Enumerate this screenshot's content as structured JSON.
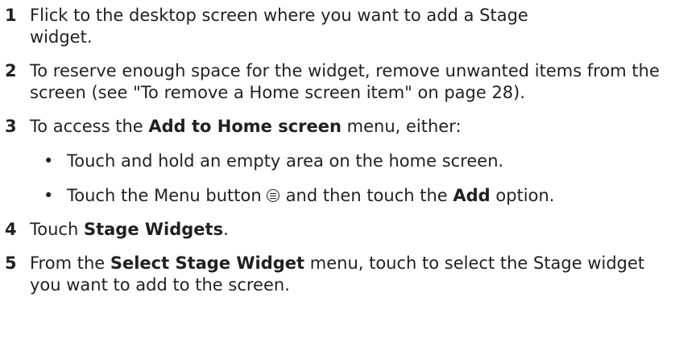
{
  "steps": [
    {
      "number": "1",
      "text": "Flick to the desktop screen where you want to add a Stage widget."
    },
    {
      "number": "2",
      "text": "To reserve enough space for the widget, remove unwanted items from the screen (see \"To remove a Home screen item\" on page 28)."
    },
    {
      "number": "3",
      "pre": "To access the ",
      "bold": "Add to Home screen",
      "post": " menu, either:",
      "bullets": [
        {
          "symbol": "•",
          "text": "Touch and hold an empty area on the home screen."
        },
        {
          "symbol": "•",
          "pre": "Touch the Menu button",
          "icon": "menu-icon",
          "mid": "and then touch the ",
          "bold": "Add",
          "post": " option."
        }
      ]
    },
    {
      "number": "4",
      "pre": "Touch ",
      "bold": "Stage Widgets",
      "post": "."
    },
    {
      "number": "5",
      "pre": "From the ",
      "bold": "Select Stage Widget",
      "post": " menu, touch to select the Stage widget you want to add to the screen."
    }
  ]
}
